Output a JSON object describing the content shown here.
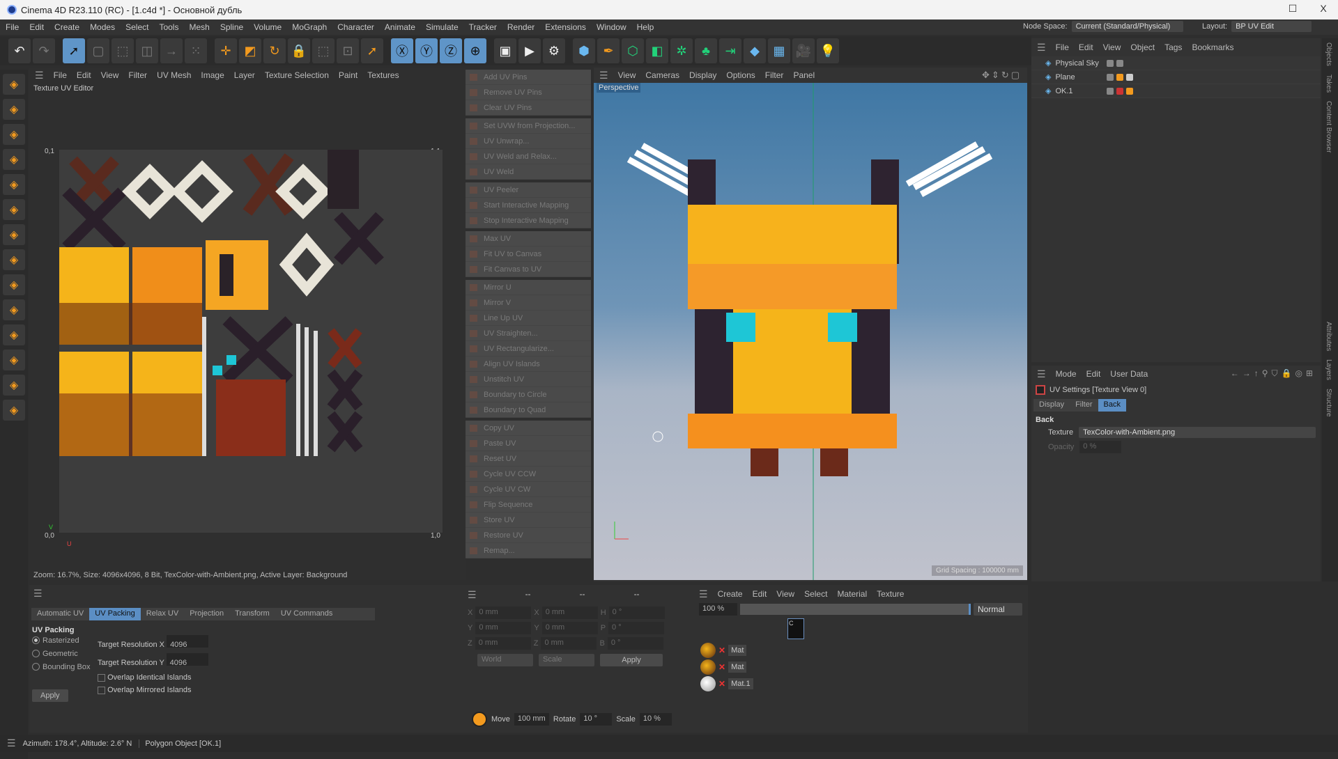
{
  "window": {
    "title": "Cinema 4D R23.110 (RC) - [1.c4d *] - Основной дубль",
    "maximize": "☐",
    "close": "X"
  },
  "menu": [
    "File",
    "Edit",
    "Create",
    "Modes",
    "Select",
    "Tools",
    "Mesh",
    "Spline",
    "Volume",
    "MoGraph",
    "Character",
    "Animate",
    "Simulate",
    "Tracker",
    "Render",
    "Extensions",
    "Window",
    "Help"
  ],
  "node_space": {
    "label": "Node Space:",
    "value": "Current (Standard/Physical)"
  },
  "layout": {
    "label": "Layout:",
    "value": "BP  UV Edit"
  },
  "toolbar": [
    {
      "icon": "undo-icon",
      "g": "↶",
      "c": "wht"
    },
    {
      "icon": "redo-icon",
      "g": "↷",
      "c": "gry"
    },
    {
      "icon": "live-selection-icon",
      "g": "➚",
      "c": "sel"
    },
    {
      "icon": "select-box-icon",
      "g": "▢",
      "c": "gry"
    },
    {
      "icon": "select-transform-icon",
      "g": "⬚",
      "c": "gry"
    },
    {
      "icon": "select-scale-icon",
      "g": "◫",
      "c": "gry"
    },
    {
      "icon": "select-line-icon",
      "g": "→",
      "c": "gry"
    },
    {
      "icon": "select-all-icon",
      "g": "⁙",
      "c": "gry"
    },
    {
      "icon": "move-icon",
      "g": "✛",
      "c": ""
    },
    {
      "icon": "scale-icon",
      "g": "◩",
      "c": ""
    },
    {
      "icon": "rotate-icon",
      "g": "↻",
      "c": ""
    },
    {
      "icon": "lock-icon",
      "g": "🔒",
      "c": ""
    },
    {
      "icon": "grid-snap-icon",
      "g": "⬚",
      "c": "gry"
    },
    {
      "icon": "snap-icon",
      "g": "⊡",
      "c": "gry"
    },
    {
      "icon": "cursor-mode-icon",
      "g": "➚",
      "c": ""
    },
    {
      "icon": "x-axis-icon",
      "g": "Ⓧ",
      "c": "sel"
    },
    {
      "icon": "y-axis-icon",
      "g": "Ⓨ",
      "c": "sel"
    },
    {
      "icon": "z-axis-icon",
      "g": "Ⓩ",
      "c": "sel"
    },
    {
      "icon": "world-coordinates-icon",
      "g": "⊕",
      "c": "sel"
    },
    {
      "icon": "render-view-icon",
      "g": "▣",
      "c": "wht"
    },
    {
      "icon": "render-picture-icon",
      "g": "▶",
      "c": "wht"
    },
    {
      "icon": "render-settings-icon",
      "g": "⚙",
      "c": "wht"
    },
    {
      "icon": "cube-icon",
      "g": "⬢",
      "c": "blu"
    },
    {
      "icon": "pen-icon",
      "g": "✒",
      "c": ""
    },
    {
      "icon": "subdivision-icon",
      "g": "⬡",
      "c": "grn"
    },
    {
      "icon": "extrude-icon",
      "g": "◧",
      "c": "grn"
    },
    {
      "icon": "cloner-icon",
      "g": "✲",
      "c": "grn"
    },
    {
      "icon": "mograph-icon",
      "g": "♣",
      "c": "grn"
    },
    {
      "icon": "deformer-icon",
      "g": "⇥",
      "c": "grn"
    },
    {
      "icon": "field-icon",
      "g": "◆",
      "c": "blu"
    },
    {
      "icon": "floor-icon",
      "g": "▦",
      "c": "blu"
    },
    {
      "icon": "camera-icon",
      "g": "🎥",
      "c": "wht"
    },
    {
      "icon": "light-icon",
      "g": "💡",
      "c": "wht"
    }
  ],
  "left_tools": [
    "model-mode-icon",
    "texture-mode-icon",
    "point-mode-icon",
    "edge-mode-icon",
    "polygon-mode-icon",
    "uv-mode-icon",
    "axis-icon",
    "solo-icon",
    "solo-selection-icon",
    "solo-hierarchy-icon",
    "magnet-icon",
    "workplane-icon",
    "grid-icon",
    "snap-settings-icon"
  ],
  "uv_editor": {
    "menu": [
      "File",
      "Edit",
      "View",
      "Filter",
      "UV Mesh",
      "Image",
      "Layer",
      "Texture Selection",
      "Paint",
      "Textures"
    ],
    "title": "Texture UV Editor",
    "axis_tl": "0,1",
    "axis_tr": "1,1",
    "axis_bl": "0,0",
    "axis_br": "1,0",
    "axis_v": "V",
    "axis_u": "U",
    "status": "Zoom: 16.7%, Size: 4096x4096, 8 Bit, TexColor-with-Ambient.png, Active Layer: Background"
  },
  "uv_commands": [
    [
      "Add UV Pins",
      "Remove UV Pins",
      "Clear UV Pins"
    ],
    [
      "Set UVW from Projection...",
      "UV Unwrap...",
      "UV Weld and Relax...",
      "UV Weld"
    ],
    [
      "UV Peeler",
      "Start Interactive Mapping",
      "Stop Interactive Mapping"
    ],
    [
      "Max UV",
      "Fit UV to Canvas",
      "Fit Canvas to UV"
    ],
    [
      "Mirror U",
      "Mirror V",
      "Line Up UV",
      "UV Straighten...",
      "UV Rectangularize...",
      "Align UV Islands",
      "Unstitch UV",
      "Boundary to Circle",
      "Boundary to Quad"
    ],
    [
      "Copy UV",
      "Paste UV",
      "Reset UV",
      "Cycle UV CCW",
      "Cycle UV CW",
      "Flip Sequence",
      "Store UV",
      "Restore UV",
      "Remap..."
    ]
  ],
  "viewport": {
    "menu": [
      "View",
      "Cameras",
      "Display",
      "Options",
      "Filter",
      "Panel"
    ],
    "label": "Perspective",
    "grid_spacing": "Grid Spacing : 100000 mm"
  },
  "objects": {
    "menu": [
      "File",
      "Edit",
      "View",
      "Object",
      "Tags",
      "Bookmarks"
    ],
    "items": [
      "Physical Sky",
      "Plane",
      "OK.1"
    ]
  },
  "attributes": {
    "menu": [
      "Mode",
      "Edit",
      "User Data"
    ],
    "title": "UV Settings [Texture View 0]",
    "tabs": [
      "Display",
      "Filter",
      "Back"
    ],
    "section": "Back",
    "texture_label": "Texture",
    "texture_value": "TexColor-with-Ambient.png",
    "opacity_label": "Opacity",
    "opacity_value": "0 %"
  },
  "side_tabs": [
    "Objects",
    "Takes",
    "Content Browser",
    "Attributes",
    "Layers",
    "Structure"
  ],
  "uv_packing": {
    "tabs": [
      "Automatic UV",
      "UV Packing",
      "Relax UV",
      "Projection",
      "Transform",
      "UV Commands"
    ],
    "heading": "UV Packing",
    "modes": [
      "Rasterized",
      "Geometric",
      "Bounding Box"
    ],
    "res_x_label": "Target Resolution X",
    "res_x": "4096",
    "res_y_label": "Target Resolution Y",
    "res_y": "4096",
    "overlap_identical": "Overlap Identical Islands",
    "overlap_mirrored": "Overlap Mirrored Islands",
    "apply": "Apply"
  },
  "coordinates": {
    "headers": [
      "--",
      "--",
      "--"
    ],
    "rows": [
      [
        "X",
        "0 mm",
        "X",
        "0 mm",
        "H",
        "0 °"
      ],
      [
        "Y",
        "0 mm",
        "Y",
        "0 mm",
        "P",
        "0 °"
      ],
      [
        "Z",
        "0 mm",
        "Z",
        "0 mm",
        "B",
        "0 °"
      ]
    ],
    "space": "World",
    "mode": "Scale",
    "apply": "Apply",
    "move_label": "Move",
    "move": "100 mm",
    "rotate_label": "Rotate",
    "rotate": "10 °",
    "scale_label": "Scale",
    "scale": "10 %"
  },
  "materials": {
    "menu": [
      "Create",
      "Edit",
      "View",
      "Select",
      "Material",
      "Texture"
    ],
    "zoom": "100 %",
    "blend": "Normal",
    "items": [
      "Mat",
      "Mat",
      "Mat.1"
    ],
    "layer_label": "C"
  },
  "status": {
    "left": "Azimuth: 178.4°, Altitude: 2.6°  N",
    "right": "Polygon Object [OK.1]"
  }
}
